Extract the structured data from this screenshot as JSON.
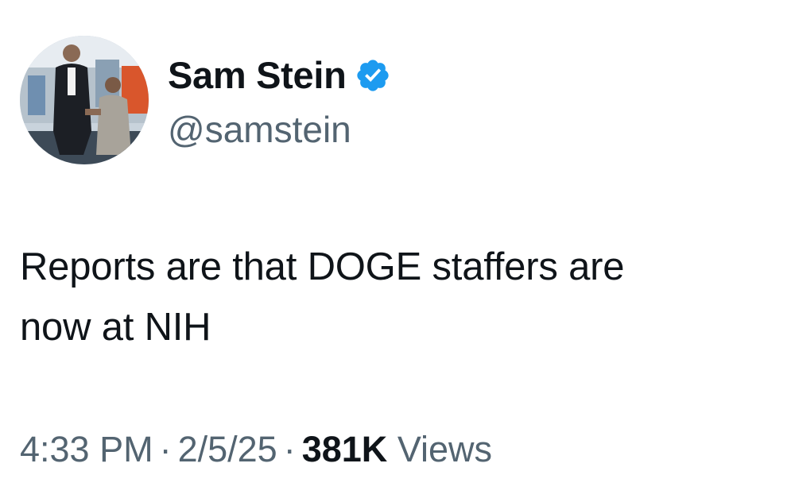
{
  "author": {
    "display_name": "Sam Stein",
    "handle": "@samstein",
    "verified": true,
    "verified_badge_color": "#1d9bf0",
    "avatar_icon": "profile-photo"
  },
  "tweet": {
    "text_line_1": "Reports are that DOGE staffers are",
    "text_line_2": "now at NIH"
  },
  "meta": {
    "time": "4:33 PM",
    "separator": "·",
    "date": "2/5/25",
    "views_count": "381K",
    "views_label": "Views"
  },
  "colors": {
    "text_primary": "#0f1419",
    "text_secondary": "#536471",
    "background": "#ffffff"
  }
}
